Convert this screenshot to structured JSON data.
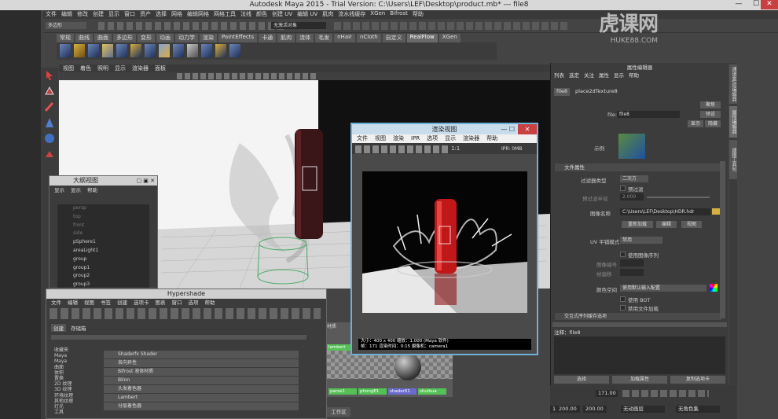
{
  "window": {
    "title": "Autodesk Maya 2015 - Trial Version: C:\\Users\\LEF\\Desktop\\product.mb*  ---  file8",
    "minimize": "—",
    "maximize": "☐",
    "close": "✕"
  },
  "main_menu": [
    "文件",
    "编辑",
    "修改",
    "创建",
    "显示",
    "窗口",
    "资产",
    "选择",
    "网格",
    "编辑网格",
    "网格工具",
    "法线",
    "颜色",
    "创建 UV",
    "编辑 UV",
    "肌肉",
    "流水线缓存",
    "XGen",
    "Bifrost",
    "帮助"
  ],
  "status": {
    "mode": "多边形",
    "search_placeholder": "无激活对象"
  },
  "shelf_tabs": [
    {
      "label": "常规",
      "active": false
    },
    {
      "label": "曲线",
      "active": false
    },
    {
      "label": "曲面",
      "active": false
    },
    {
      "label": "多边形",
      "active": false
    },
    {
      "label": "变形",
      "active": false
    },
    {
      "label": "动画",
      "active": false
    },
    {
      "label": "动力学",
      "active": false
    },
    {
      "label": "渲染",
      "active": false
    },
    {
      "label": "PaintEffects",
      "active": false
    },
    {
      "label": "卡通",
      "active": false
    },
    {
      "label": "肌肉",
      "active": false
    },
    {
      "label": "流体",
      "active": false
    },
    {
      "label": "毛发",
      "active": false
    },
    {
      "label": "nHair",
      "active": false
    },
    {
      "label": "nCloth",
      "active": false
    },
    {
      "label": "自定义",
      "active": false
    },
    {
      "label": "RealFlow",
      "active": true
    },
    {
      "label": "XGen",
      "active": false
    }
  ],
  "viewport_menu": [
    "视图",
    "着色",
    "照明",
    "显示",
    "渲染器",
    "面板"
  ],
  "outliner": {
    "title": "大纲视图",
    "menu": [
      "显示",
      "显示",
      "帮助"
    ],
    "items": [
      {
        "label": "persp",
        "dim": true
      },
      {
        "label": "top",
        "dim": true
      },
      {
        "label": "front",
        "dim": true
      },
      {
        "label": "side",
        "dim": true
      },
      {
        "label": "pSphere1",
        "dim": false
      },
      {
        "label": "areaLight1",
        "dim": false
      },
      {
        "label": "group",
        "dim": false
      },
      {
        "label": "group1",
        "dim": false
      },
      {
        "label": "group2",
        "dim": false
      },
      {
        "label": "group3",
        "dim": false
      }
    ]
  },
  "hypershade": {
    "title": "Hypershade",
    "menu": [
      "文件",
      "编辑",
      "视图",
      "书签",
      "创建",
      "选项卡",
      "图表",
      "窗口",
      "选项",
      "帮助"
    ],
    "tabs": [
      "创建",
      "存储箱"
    ],
    "categories": [
      "收藏夹",
      "Maya",
      "Maya",
      "曲面",
      "体积",
      "置换",
      "2D 纹理",
      "3D 纹理",
      "环境纹理",
      "其他纹理",
      "灯光",
      "工具"
    ],
    "items": [
      "Shaderfx Shader",
      "各向异性",
      "Bifrost 液体材质",
      "Blinn",
      "头发着色器",
      "Lambert",
      "分层着色器"
    ],
    "swatches": [
      "lambert",
      "parse1",
      "phongE1",
      "shader01",
      "shuibua"
    ],
    "panel_tab": "材质",
    "work_tab": "工作区"
  },
  "render_view": {
    "title": "渲染视图",
    "menu": [
      "文件",
      "视图",
      "渲染",
      "IPR",
      "选项",
      "显示",
      "渲染器",
      "帮助"
    ],
    "ratio": "1:1",
    "ipr": "IPR: 0MB",
    "status_line1": "大小：400 x 400   缩放：1.000          (Maya 软件)",
    "status_line2": "帧：171    渲染时间：0:15              摄像机：camera1"
  },
  "attribute_editor": {
    "title": "属性编辑器",
    "menu": [
      "列表",
      "选定",
      "关注",
      "属性",
      "显示",
      "帮助"
    ],
    "tabs": [
      "file8",
      "place2dTexture8"
    ],
    "file_label": "file:",
    "file_value": "file8",
    "buttons": {
      "focus": "聚焦",
      "preset": "预设",
      "show": "显示",
      "hide": "隐藏"
    },
    "sample_label": "示例",
    "section": "文件属性",
    "filter_type_label": "过滤器类型",
    "filter_type_value": "二次方",
    "pre_filter": "预过滤",
    "pre_filter_radius": "预过滤半径",
    "pre_filter_radius_value": "2.000",
    "image_name_label": "图像名称",
    "image_name_value": "C:\\Users\\LEF\\Desktop\\HDR.hdr",
    "reload": "重新加载",
    "edit": "编辑",
    "view": "视图",
    "uv_tiling_label": "UV 平铺模式",
    "uv_tiling_value": "禁用",
    "use_sequence": "使用图像序列",
    "image_number": "图像编号",
    "frame_offset": "帧偏移",
    "color_space_label": "颜色空间",
    "color_space_value": "使用默认输入配置",
    "use_bot": "使用 BOT",
    "disable_caching": "禁用文件加载",
    "interactive_section": "交互式序列缓存选项",
    "notes_label": "注释：file8",
    "bottom_buttons": [
      "选择",
      "加载属性",
      "复制选项卡"
    ]
  },
  "right_tabs": [
    "通道盒/层编辑器",
    "属性编辑器",
    "建模工具包"
  ],
  "timeline": {
    "current": "171.00",
    "start": "1.00",
    "range_a": "200.00",
    "range_b": "200.00",
    "anim_layer": "无动画层",
    "char_set": "无角色集"
  },
  "watermark": {
    "text": "虎课网",
    "url": "HUKE88.COM"
  },
  "colors": {
    "accent_blue": "#6fb0d6",
    "swatch_green": "#55c055"
  }
}
